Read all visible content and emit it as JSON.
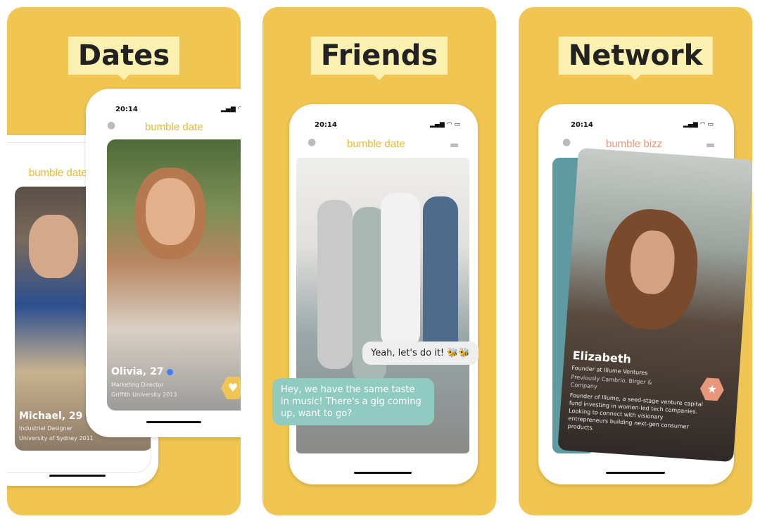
{
  "panels": [
    {
      "title": "Dates",
      "status_time": "20:14",
      "back_card": {
        "logo": "bumble date",
        "name": "Michael, 29",
        "line1": "Industrial Designer",
        "line2": "University of Sydney 2011"
      },
      "front_card": {
        "logo": "bumble date",
        "name": "Olivia, 27",
        "line1": "Marketing Director",
        "line2": "Griffith University 2013",
        "action_icon": "heart-icon"
      }
    },
    {
      "title": "Friends",
      "status_time": "20:14",
      "logo": "bumble date",
      "messages": [
        {
          "text": "Yeah, let's do it! 🐝🐝"
        },
        {
          "text": "Hey, we have the same taste in music! There's a gig coming up, want to go?"
        }
      ]
    },
    {
      "title": "Network",
      "status_time": "20:14",
      "logo": "bumble bizz",
      "card": {
        "name": "Elizabeth",
        "line1": "Founder at Illume Ventures",
        "line2": "Previously Cambrio, Birger & Company",
        "bio": "Founder of Illume, a seed-stage venture capital fund investing in women-led tech companies. Looking to connect with visionary entrepreneurs building next-gen consumer products.",
        "action_icon": "star-icon"
      }
    }
  ],
  "colors": {
    "background": "#F0C551",
    "title_highlight": "#FCF1B0",
    "brand": "#E8B92E",
    "teal_bubble": "#8FCBC0",
    "bizz_badge": "#E8977A"
  }
}
